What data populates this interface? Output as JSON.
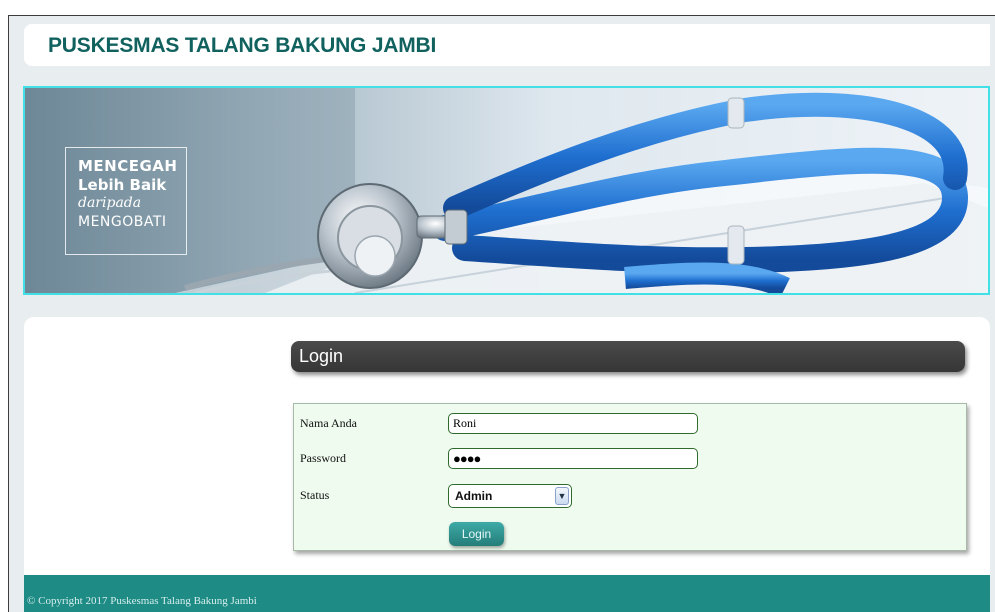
{
  "header": {
    "title": "PUSKESMAS TALANG BAKUNG JAMBI"
  },
  "banner": {
    "slogan": {
      "line1": "MENCEGAH",
      "line2": "Lebih Baik",
      "line3": "daripada",
      "line4": "MENGOBATI"
    }
  },
  "login": {
    "title": "Login",
    "fields": {
      "name_label": "Nama Anda",
      "name_value": "Roni",
      "password_label": "Password",
      "password_value": "●●●●",
      "status_label": "Status",
      "status_value": "Admin"
    },
    "submit_label": "Login"
  },
  "footer": {
    "copyright": "© Copyright 2017 Puskesmas Talang Bakung Jambi"
  },
  "colors": {
    "title": "#11625f",
    "footer": "#1e8b85",
    "banner_border": "#40e0e6",
    "login_bg": "#effbef"
  },
  "icons": {
    "select_arrow": "chevron-down-icon"
  }
}
